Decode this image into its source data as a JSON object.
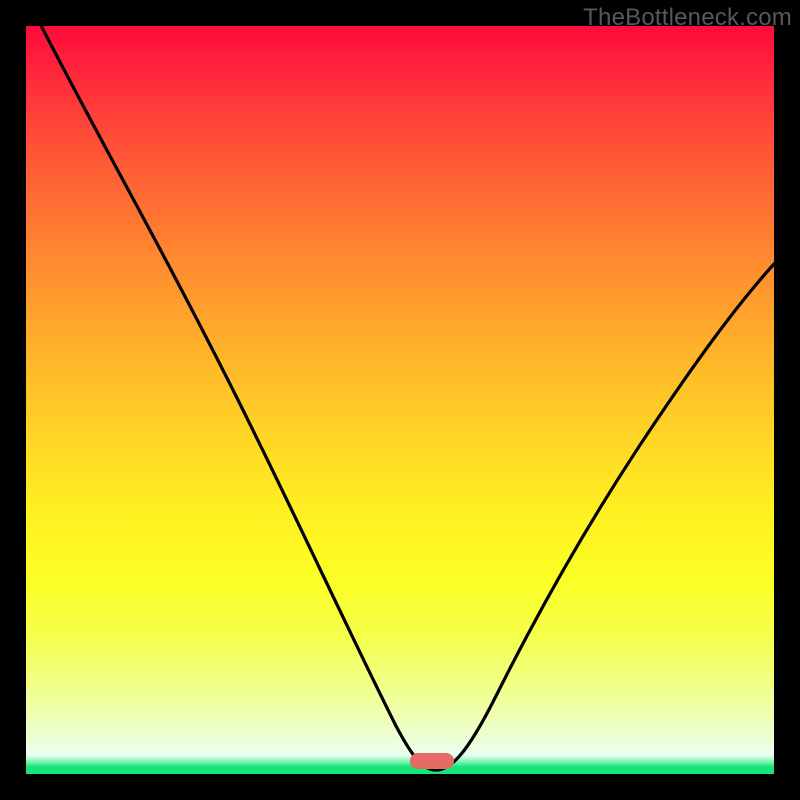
{
  "watermark": "TheBottleneck.com",
  "chart_data": {
    "type": "line",
    "title": "",
    "xlabel": "",
    "ylabel": "",
    "xlim": [
      0,
      100
    ],
    "ylim": [
      0,
      100
    ],
    "grid": false,
    "legend": false,
    "series": [
      {
        "name": "bottleneck-curve",
        "x": [
          0,
          10,
          20,
          30,
          38,
          44,
          49,
          52,
          54,
          55,
          58,
          62,
          68,
          76,
          86,
          100
        ],
        "values": [
          104,
          90,
          74,
          56,
          40,
          26,
          12,
          4,
          1,
          0,
          2,
          8,
          20,
          36,
          52,
          68
        ]
      }
    ],
    "marker": {
      "x": 55,
      "color": "#e86a67"
    },
    "gradient_stops": [
      {
        "pos": 0,
        "color": "#ff0a3d"
      },
      {
        "pos": 0.65,
        "color": "#fff021"
      },
      {
        "pos": 0.985,
        "color": "#14e779"
      }
    ]
  }
}
